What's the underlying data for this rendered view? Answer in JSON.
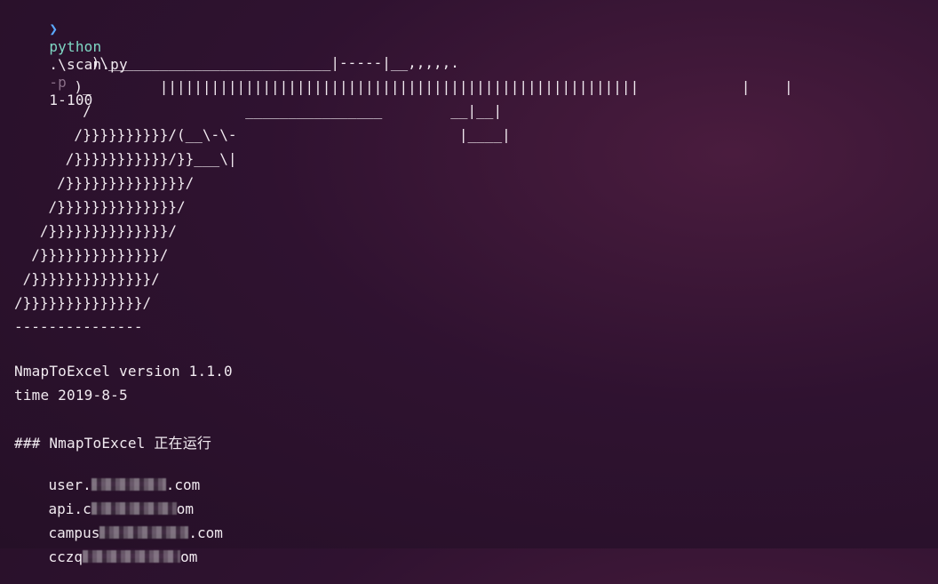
{
  "prompt": {
    "arrow": "❯",
    "command": "python",
    "arg_script": ".\\scan.py",
    "flag": "-p",
    "ports": "1-100"
  },
  "ascii_art": [
    "         )\\__________________________|-----|__,,,,,.",
    "       )_        ||||||||||||||||||||||||||||||||||||||||||||||||||||||||            |    |",
    "        /                  ________________        __|__|",
    "       /}}}}}}}}}}/(__\\-\\-                          |____|",
    "      /}}}}}}}}}}}/}}___\\|",
    "     /}}}}}}}}}}}}}}/",
    "    /}}}}}}}}}}}}}}/",
    "   /}}}}}}}}}}}}}}/",
    "  /}}}}}}}}}}}}}}/",
    " /}}}}}}}}}}}}}}/",
    "/}}}}}}}}}}}}}}/",
    "---------------"
  ],
  "info": {
    "version_line": "NmapToExcel version 1.1.0",
    "time_line": "time 2019-8-5",
    "status_line": "### NmapToExcel 正在运行"
  },
  "hosts": [
    {
      "prefix": "user.",
      "suffix": ".com"
    },
    {
      "prefix": "api.c",
      "suffix": "om"
    },
    {
      "prefix": "campus",
      "suffix": ".com"
    },
    {
      "prefix": "cczq",
      "suffix": "om"
    }
  ]
}
